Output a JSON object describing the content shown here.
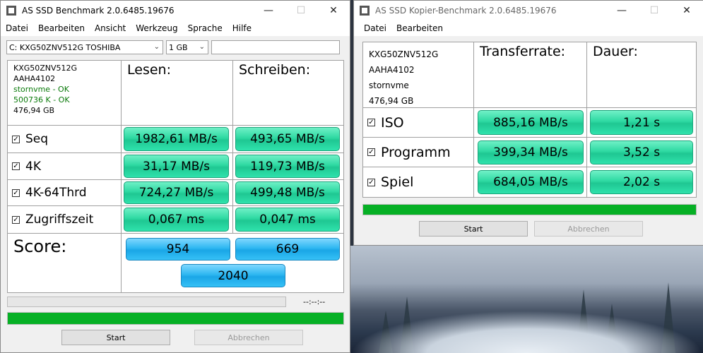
{
  "main": {
    "title": "AS SSD Benchmark 2.0.6485.19676",
    "menu": [
      "Datei",
      "Bearbeiten",
      "Ansicht",
      "Werkzeug",
      "Sprache",
      "Hilfe"
    ],
    "drive_select": "C: KXG50ZNV512G TOSHIBA",
    "size_select": "1 GB",
    "info": {
      "model": "KXG50ZNV512G",
      "firmware": "AAHA4102",
      "driver": "stornvme - OK",
      "alignment": "500736 K - OK",
      "capacity": "476,94 GB"
    },
    "col_read": "Lesen:",
    "col_write": "Schreiben:",
    "rows": [
      {
        "label": "Seq",
        "read": "1982,61 MB/s",
        "write": "493,65 MB/s"
      },
      {
        "label": "4K",
        "read": "31,17 MB/s",
        "write": "119,73 MB/s"
      },
      {
        "label": "4K-64Thrd",
        "read": "724,27 MB/s",
        "write": "499,48 MB/s"
      },
      {
        "label": "Zugriffszeit",
        "read": "0,067 ms",
        "write": "0,047 ms"
      }
    ],
    "score_label": "Score:",
    "score_read": "954",
    "score_write": "669",
    "score_total": "2040",
    "time": "--:--:--",
    "progress_small": 0,
    "progress_main": 1.0,
    "start_label": "Start",
    "abort_label": "Abbrechen"
  },
  "copy": {
    "title": "AS SSD Kopier-Benchmark 2.0.6485.19676",
    "menu": [
      "Datei",
      "Bearbeiten"
    ],
    "info": {
      "model": "KXG50ZNV512G",
      "firmware": "AAHA4102",
      "driver": "stornvme",
      "capacity": "476,94 GB"
    },
    "col_rate": "Transferrate:",
    "col_dur": "Dauer:",
    "rows": [
      {
        "label": "ISO",
        "rate": "885,16 MB/s",
        "dur": "1,21 s"
      },
      {
        "label": "Programm",
        "rate": "399,34 MB/s",
        "dur": "3,52 s"
      },
      {
        "label": "Spiel",
        "rate": "684,05 MB/s",
        "dur": "2,02 s"
      }
    ],
    "progress": 1.0,
    "start_label": "Start",
    "abort_label": "Abbrechen"
  },
  "colors": {
    "value_box": "#2ed9a2",
    "score_box": "#2db7f1",
    "progress": "#06b025",
    "ok_text": "#0a7a0a"
  },
  "icons": {
    "minimize": "minimize-icon",
    "maximize": "maximize-icon",
    "close": "close-icon",
    "checkbox": "checkbox-checked-icon",
    "dropdown": "chevron-down-icon"
  }
}
